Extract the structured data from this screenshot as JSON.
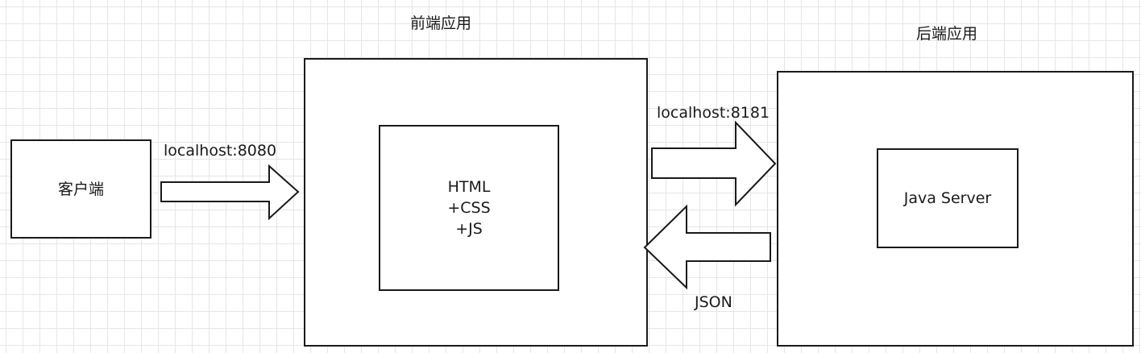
{
  "diagram": {
    "client": {
      "label": "客户端"
    },
    "frontend": {
      "title": "前端应用",
      "inner_label": "HTML\n+CSS\n+JS"
    },
    "backend": {
      "title": "后端应用",
      "inner_label": "Java Server"
    },
    "edges": {
      "client_to_frontend": {
        "label": "localhost:8080"
      },
      "frontend_to_backend": {
        "label": "localhost:8181"
      },
      "backend_to_frontend": {
        "label": "JSON"
      }
    }
  },
  "colors": {
    "stroke": "#1a1a1a",
    "grid": "#e6e6e6",
    "background": "#ffffff"
  }
}
